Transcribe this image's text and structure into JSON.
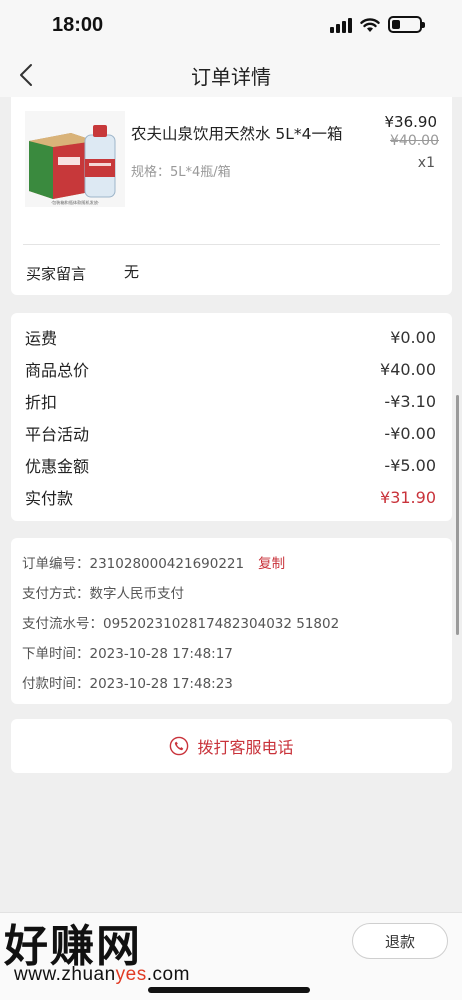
{
  "status_bar": {
    "time": "18:00"
  },
  "nav": {
    "title": "订单详情"
  },
  "product": {
    "name": "农夫山泉饮用天然水 5L*4一箱",
    "spec": "规格：5L*4瓶/箱",
    "price": "¥36.90",
    "original_price": "¥40.00",
    "quantity": "x1",
    "image_brand_text": "农夫山泉",
    "image_caption": "·包装箱和瓶体款随机发放·"
  },
  "note": {
    "label": "买家留言",
    "value": "无"
  },
  "costs": [
    {
      "label": "运费",
      "value": "¥0.00",
      "highlight": false
    },
    {
      "label": "商品总价",
      "value": "¥40.00",
      "highlight": false
    },
    {
      "label": "折扣",
      "value": "-¥3.10",
      "highlight": false
    },
    {
      "label": "平台活动",
      "value": "-¥0.00",
      "highlight": false
    },
    {
      "label": "优惠金额",
      "value": "-¥5.00",
      "highlight": false
    },
    {
      "label": "实付款",
      "value": "¥31.90",
      "highlight": true
    }
  ],
  "order_info": {
    "order_no_label": "订单编号：",
    "order_no": "231028000421690221",
    "copy_label": "复制",
    "pay_method_label": "支付方式：",
    "pay_method": "数字人民币支付",
    "pay_serial_label": "支付流水号：",
    "pay_serial": "0952023102817482304032 51802",
    "order_time_label": "下单时间：",
    "order_time": "2023-10-28 17:48:17",
    "pay_time_label": "付款时间：",
    "pay_time": "2023-10-28 17:48:23"
  },
  "call_service": {
    "label": "拨打客服电话"
  },
  "bottom": {
    "refund_label": "退款"
  },
  "watermark": {
    "brand": "好赚网",
    "url_prefix": "www.zhuan",
    "url_highlight": "yes",
    "url_suffix": ".com"
  },
  "colors": {
    "accent_red": "#c9333b",
    "background": "#efefef"
  }
}
